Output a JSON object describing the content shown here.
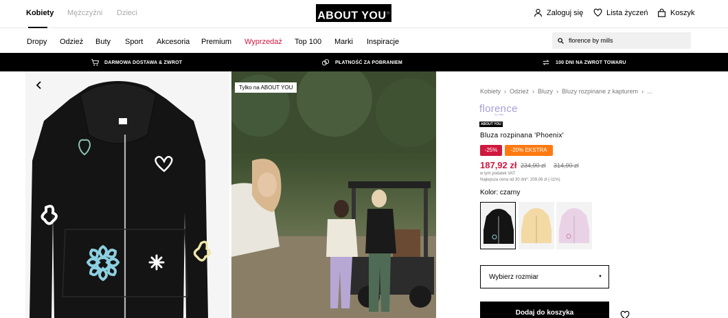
{
  "header": {
    "genders": [
      "Kobiety",
      "Mężczyźni",
      "Dzieci"
    ],
    "logo": "ABOUT YOU",
    "account": {
      "login": "Zaloguj się",
      "wishlist": "Lista życzeń",
      "cart": "Koszyk"
    }
  },
  "nav": {
    "items": [
      "Dropy",
      "Odzież",
      "Buty",
      "Sport",
      "Akcesoria",
      "Premium",
      "Wyprzedaż",
      "Top 100",
      "Marki",
      "Inspiracje"
    ],
    "search_value": "florence by mills"
  },
  "usps": [
    "DARMOWA DOSTAWA & ZWROT",
    "PŁATNOŚĆ ZA POBRANIEM",
    "100 DNI NA ZWROT TOWARU"
  ],
  "gallery": {
    "badge": "Tylko na ABOUT YOU"
  },
  "product": {
    "breadcrumbs": [
      "Kobiety",
      "Odzież",
      "Bluzy",
      "Bluzy rozpinane z kapturem",
      "..."
    ],
    "brand": "florence",
    "brand_sub": "by mills",
    "brand_tag": "ABOUT YOU",
    "name": "Bluza rozpinana 'Phoenix'",
    "discount": "-25%",
    "extra_discount": "-20% EKSTRA",
    "price": "187,92 zł",
    "old_price_1": "234,90 zł",
    "old_price_2": "314,90 zł",
    "vat_note": "w tym podatek VAT",
    "lowest_price": "Najlepsza cena od 30 dni*: 209,06 zł (-11%)",
    "color_label": "Kolor: czarny",
    "size_select": "Wybierz rozmiar",
    "add_to_cart": "Dodaj do koszyka"
  }
}
